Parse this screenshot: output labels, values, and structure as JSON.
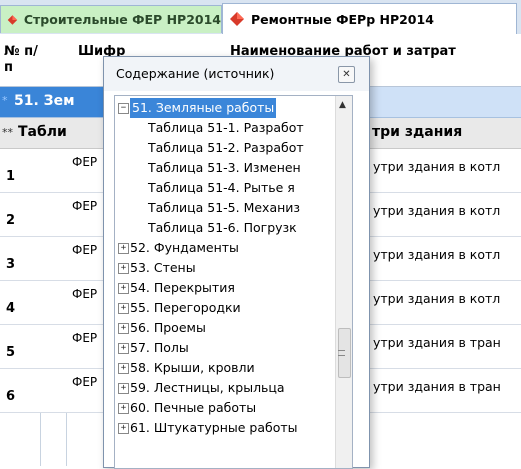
{
  "tabs": [
    {
      "label": "Строительные ФЕР НР2014",
      "active": false,
      "icon": "diamond-icon"
    },
    {
      "label": "Ремонтные ФЕРр НР2014",
      "active": true,
      "icon": "diamond-icon"
    }
  ],
  "table": {
    "headers": {
      "num": "№ п/п",
      "code": "Шифр",
      "name": "Наименование работ и затрат"
    },
    "section": {
      "marker": "*",
      "label": "51. Зем"
    },
    "subsection": {
      "marker": "**",
      "label": "Табли",
      "suffix": "три здания"
    },
    "rows": [
      {
        "num": "1",
        "code": "ФЕР",
        "desc": "утри здания в котл"
      },
      {
        "num": "2",
        "code": "ФЕР",
        "desc": "утри здания в котл"
      },
      {
        "num": "3",
        "code": "ФЕР",
        "desc": "утри здания в котл"
      },
      {
        "num": "4",
        "code": "ФЕР",
        "desc": "утри здания в котл"
      },
      {
        "num": "5",
        "code": "ФЕР",
        "desc": "утри здания в тран"
      },
      {
        "num": "6",
        "code": "ФЕР",
        "desc": "утри здания в тран"
      }
    ]
  },
  "dialog": {
    "title": "Содержание (источник)",
    "close_icon": "close-icon",
    "tree": [
      {
        "label": "51. Земляные работы",
        "expanded": true,
        "selected": true
      },
      {
        "label": "Таблица 51-1. Разработ",
        "child": true
      },
      {
        "label": "Таблица 51-2. Разработ",
        "child": true
      },
      {
        "label": "Таблица 51-3. Изменен",
        "child": true
      },
      {
        "label": "Таблица 51-4. Рытье я",
        "child": true
      },
      {
        "label": "Таблица 51-5. Механиз",
        "child": true
      },
      {
        "label": "Таблица 51-6. Погрузк",
        "child": true
      },
      {
        "label": "52. Фундаменты",
        "expanded": false
      },
      {
        "label": "53. Стены",
        "expanded": false
      },
      {
        "label": "54. Перекрытия",
        "expanded": false
      },
      {
        "label": "55. Перегородки",
        "expanded": false
      },
      {
        "label": "56. Проемы",
        "expanded": false
      },
      {
        "label": "57. Полы",
        "expanded": false
      },
      {
        "label": "58. Крыши, кровли",
        "expanded": false
      },
      {
        "label": "59. Лестницы, крыльца",
        "expanded": false
      },
      {
        "label": "60. Печные работы",
        "expanded": false
      },
      {
        "label": "61. Штукатурные работы",
        "expanded": false
      }
    ]
  }
}
